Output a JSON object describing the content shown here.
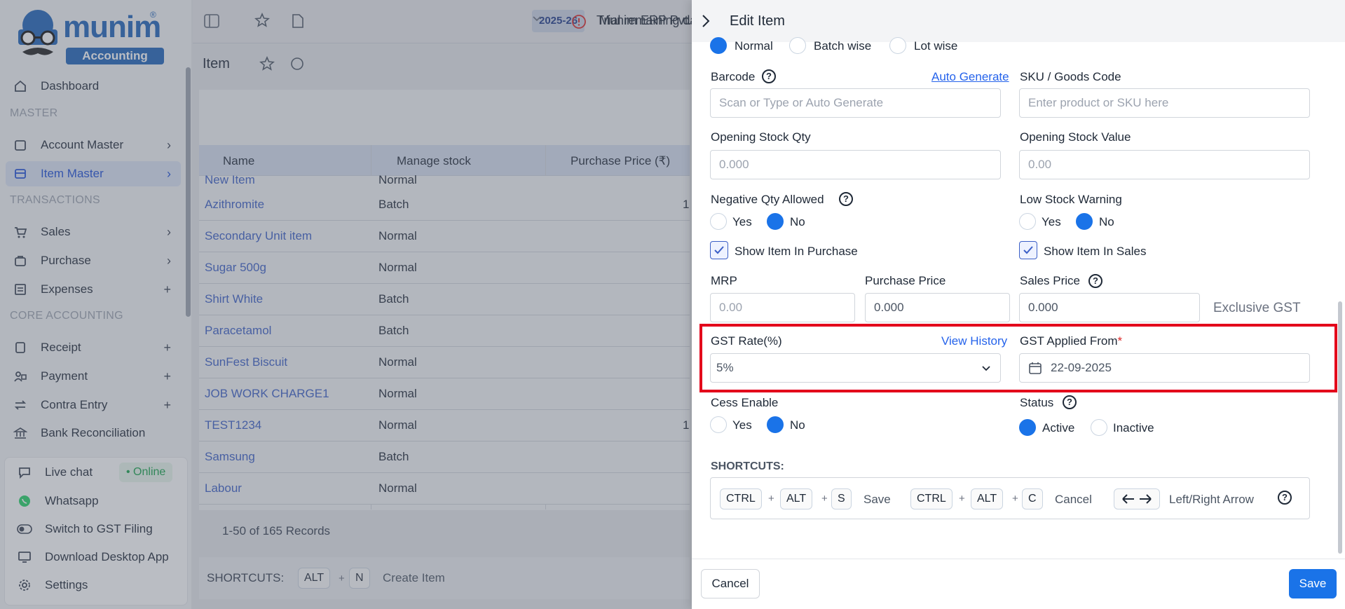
{
  "sidebar": {
    "brand": "munim",
    "brand_sub": "Accounting",
    "reg_mark": "®",
    "sections": {
      "master": "MASTER",
      "transactions": "TRANSACTIONS",
      "core": "CORE ACCOUNTING"
    },
    "items": {
      "dashboard": "Dashboard",
      "account_master": "Account Master",
      "item_master": "Item Master",
      "sales": "Sales",
      "purchase": "Purchase",
      "expenses": "Expenses",
      "receipt": "Receipt",
      "payment": "Payment",
      "contra": "Contra Entry",
      "bank_rec": "Bank Reconciliation"
    },
    "bottom": {
      "live_chat": "Live chat",
      "online": "• Online",
      "whatsapp": "Whatsapp",
      "gst": "Switch to GST Filing",
      "desktop": "Download Desktop App",
      "settings": "Settings"
    }
  },
  "topbar": {
    "year": "2025-26",
    "company": "Munim ERP Pvt. Ltd.",
    "trial": "Trial remaining da"
  },
  "list": {
    "title": "Item",
    "columns": {
      "name": "Name",
      "stock": "Manage stock",
      "price": "Purchase Price (₹)"
    },
    "partial_row": {
      "name": "New Item",
      "stock": "Normal"
    },
    "rows": [
      {
        "name": "Azithromite",
        "stock": "Batch",
        "price": "1"
      },
      {
        "name": "Secondary Unit item",
        "stock": "Normal",
        "price": ""
      },
      {
        "name": "Sugar 500g",
        "stock": "Normal",
        "price": ""
      },
      {
        "name": "Shirt White",
        "stock": "Batch",
        "price": ""
      },
      {
        "name": "Paracetamol",
        "stock": "Batch",
        "price": ""
      },
      {
        "name": "SunFest Biscuit",
        "stock": "Normal",
        "price": ""
      },
      {
        "name": "JOB WORK CHARGE1",
        "stock": "Normal",
        "price": ""
      },
      {
        "name": "TEST1234",
        "stock": "Normal",
        "price": "1"
      },
      {
        "name": "Samsung",
        "stock": "Batch",
        "price": ""
      },
      {
        "name": "Labour",
        "stock": "Normal",
        "price": ""
      }
    ],
    "records": "1-50 of 165 Records",
    "shortcuts_label": "SHORTCUTS:",
    "shortcut_keys": [
      "ALT",
      "N"
    ],
    "shortcut_action": "Create Item"
  },
  "drawer": {
    "title": "Edit Item",
    "stock_type": {
      "normal": "Normal",
      "batch": "Batch wise",
      "lot": "Lot wise"
    },
    "barcode": {
      "label": "Barcode",
      "link": "Auto Generate",
      "placeholder": "Scan or Type or Auto Generate"
    },
    "sku": {
      "label": "SKU / Goods Code",
      "placeholder": "Enter product or SKU here"
    },
    "opening_qty": {
      "label": "Opening Stock Qty",
      "placeholder": "0.000"
    },
    "opening_value": {
      "label": "Opening Stock Value",
      "placeholder": "0.00"
    },
    "negative_qty": {
      "label": "Negative Qty Allowed",
      "yes": "Yes",
      "no": "No"
    },
    "low_stock": {
      "label": "Low Stock Warning",
      "yes": "Yes",
      "no": "No"
    },
    "show_purchase": "Show Item In Purchase",
    "show_sales": "Show Item In Sales",
    "mrp": {
      "label": "MRP",
      "placeholder": "0.00"
    },
    "purchase_price": {
      "label": "Purchase Price",
      "value": "0.000"
    },
    "sales_price": {
      "label": "Sales Price",
      "value": "0.000",
      "suffix": "Exclusive GST"
    },
    "gst_rate": {
      "label": "GST Rate(%)",
      "link": "View History",
      "value": "5%"
    },
    "gst_from": {
      "label": "GST Applied From",
      "required": "*",
      "value": "22-09-2025"
    },
    "cess": {
      "label": "Cess Enable",
      "yes": "Yes",
      "no": "No"
    },
    "status": {
      "label": "Status",
      "active": "Active",
      "inactive": "Inactive"
    },
    "shortcuts": {
      "label": "SHORTCUTS:",
      "ctrl": "CTRL",
      "alt": "ALT",
      "s": "S",
      "c": "C",
      "save": "Save",
      "cancel": "Cancel",
      "arrows": "Left/Right Arrow"
    },
    "footer": {
      "cancel": "Cancel",
      "save": "Save"
    }
  },
  "colors": {
    "primary": "#1a73e8",
    "brand": "#1e63b8",
    "highlight": "#e3001b",
    "link": "#3b5fc7"
  }
}
